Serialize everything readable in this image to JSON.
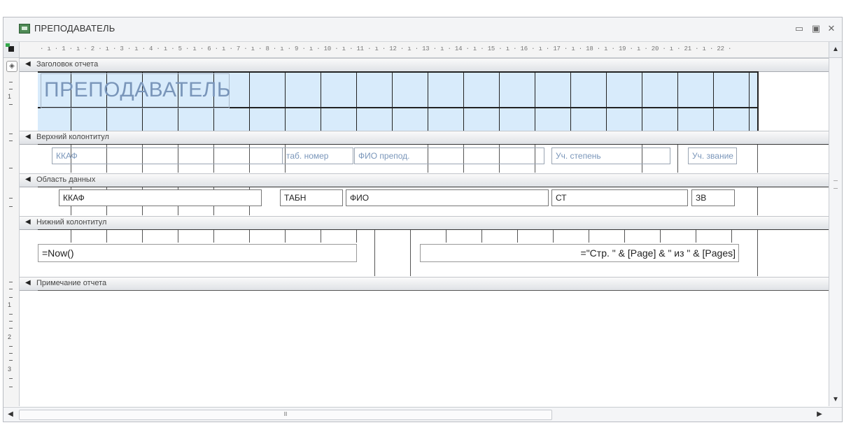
{
  "window": {
    "title": "ПРЕПОДАВАТЕЛЬ"
  },
  "ruler": {
    "text": "· ı · 1 · ı · 2 · ı · 3 · ı · 4 · ı · 5 · ı · 6 · ı · 7 · ı · 8 · ı · 9 · ı · 10 · ı · 11 · ı · 12 · ı · 13 · ı · 14 · ı · 15 · ı · 16 · ı · 17 · ı · 18 · ı · 19 · ı · 20 · ı · 21 · ı · 22 ·"
  },
  "vruler_numbers": [
    "1",
    "1",
    "2",
    "3"
  ],
  "sections": {
    "report_header": "Заголовок отчета",
    "page_header": "Верхний колонтитул",
    "detail": "Область данных",
    "page_footer": "Нижний колонтитул",
    "report_footer": "Примечание отчета"
  },
  "report_title": "ПРЕПОДАВАТЕЛЬ",
  "page_header_labels": {
    "kaf": "ККАФ",
    "tab": "таб. номер",
    "fio": "ФИО препод.",
    "st": "Уч. степень",
    "zv": "Уч. звание"
  },
  "detail_fields": {
    "kaf": "ККАФ",
    "tab": "ТАБН",
    "fio": "ФИО",
    "st": "СТ",
    "zv": "ЗВ"
  },
  "footer_fields": {
    "now": "=Now()",
    "pages": "=\"Стр. \" & [Page] & \" из \" & [Pages]"
  },
  "icons": {
    "arrow": "◀",
    "selector": "◈",
    "minimize": "▭",
    "restore": "▣",
    "close": "✕",
    "up": "▲",
    "down": "▼",
    "left": "◀",
    "right": "▶",
    "grip": "Ⅲ"
  }
}
